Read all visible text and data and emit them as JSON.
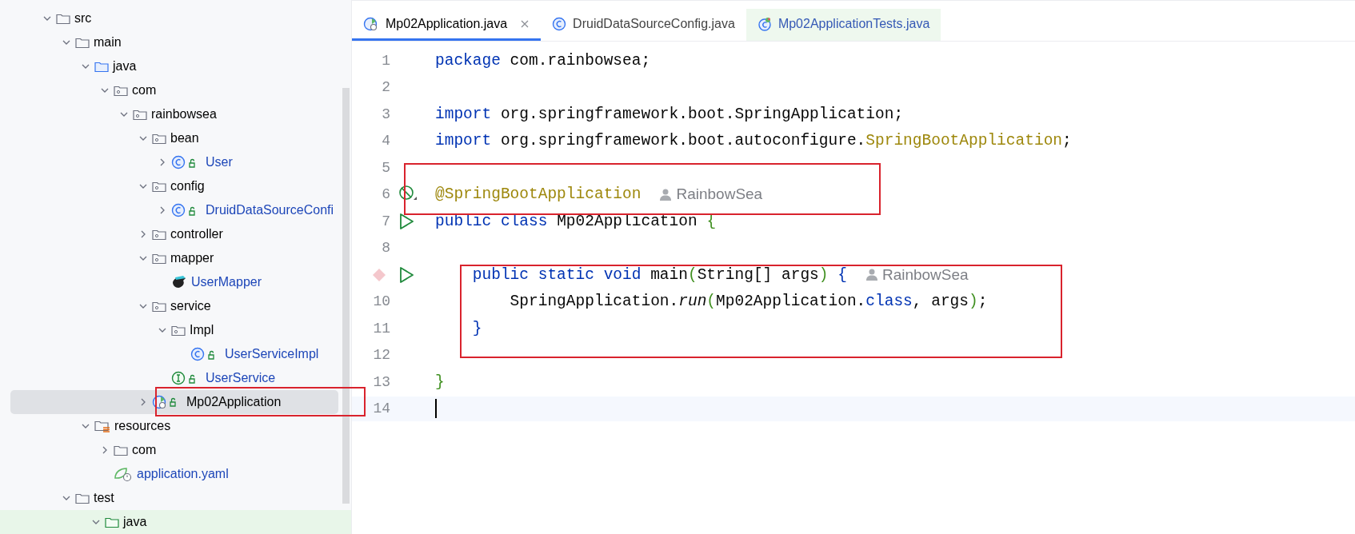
{
  "project_tree": {
    "items": [
      {
        "label": "src",
        "kind": "folder",
        "expanded": true,
        "selected": false,
        "highlighted": false,
        "children": [
          {
            "label": "main",
            "kind": "folder",
            "expanded": true,
            "selected": false,
            "highlighted": false,
            "children": [
              {
                "label": "java",
                "kind": "source-folder",
                "expanded": true,
                "selected": false,
                "highlighted": false,
                "children": [
                  {
                    "label": "com",
                    "kind": "package",
                    "expanded": true,
                    "selected": false,
                    "highlighted": false,
                    "children": [
                      {
                        "label": "rainbowsea",
                        "kind": "package",
                        "expanded": true,
                        "selected": false,
                        "highlighted": false,
                        "children": [
                          {
                            "label": "bean",
                            "kind": "package",
                            "expanded": true,
                            "selected": false,
                            "highlighted": false,
                            "children": [
                              {
                                "label": "User",
                                "kind": "class",
                                "expanded": false,
                                "selected": false,
                                "highlighted": false
                              }
                            ]
                          },
                          {
                            "label": "config",
                            "kind": "package",
                            "expanded": true,
                            "selected": false,
                            "highlighted": false,
                            "children": [
                              {
                                "label": "DruidDataSourceConfi",
                                "kind": "class",
                                "expanded": false,
                                "selected": false,
                                "highlighted": false
                              }
                            ]
                          },
                          {
                            "label": "controller",
                            "kind": "package",
                            "expanded": false,
                            "selected": false,
                            "highlighted": false
                          },
                          {
                            "label": "mapper",
                            "kind": "package",
                            "expanded": true,
                            "selected": false,
                            "highlighted": false,
                            "children": [
                              {
                                "label": "UserMapper",
                                "kind": "mapper",
                                "selected": false,
                                "highlighted": false
                              }
                            ]
                          },
                          {
                            "label": "service",
                            "kind": "package",
                            "expanded": true,
                            "selected": false,
                            "highlighted": false,
                            "children": [
                              {
                                "label": "Impl",
                                "kind": "package",
                                "expanded": true,
                                "selected": false,
                                "highlighted": false,
                                "children": [
                                  {
                                    "label": "UserServiceImpl",
                                    "kind": "class",
                                    "selected": false,
                                    "highlighted": false
                                  }
                                ]
                              },
                              {
                                "label": "UserService",
                                "kind": "interface",
                                "selected": false,
                                "highlighted": false
                              }
                            ]
                          },
                          {
                            "label": "Mp02Application",
                            "kind": "boot-class",
                            "expanded": false,
                            "selected": true,
                            "highlighted": false
                          }
                        ]
                      }
                    ]
                  }
                ]
              },
              {
                "label": "resources",
                "kind": "resources-folder",
                "expanded": true,
                "selected": false,
                "highlighted": false,
                "children": [
                  {
                    "label": "com",
                    "kind": "folder",
                    "expanded": false,
                    "selected": false,
                    "highlighted": false
                  },
                  {
                    "label": "application.yaml",
                    "kind": "yaml",
                    "selected": false,
                    "highlighted": false
                  }
                ]
              }
            ]
          },
          {
            "label": "test",
            "kind": "folder",
            "expanded": true,
            "selected": false,
            "highlighted": false,
            "children": [
              {
                "label": "java",
                "kind": "test-folder",
                "expanded": true,
                "selected": false,
                "highlighted": true
              }
            ]
          }
        ]
      }
    ]
  },
  "tabs": [
    {
      "label": "Mp02Application.java",
      "kind": "boot-class",
      "selected": true
    },
    {
      "label": "DruidDataSourceConfig.java",
      "kind": "class",
      "selected": false
    },
    {
      "label": "Mp02ApplicationTests.java",
      "kind": "test-class",
      "selected": false
    }
  ],
  "code": {
    "lines": [
      {
        "number": "1",
        "tokens": [
          {
            "text": "package",
            "kind": "keyword"
          },
          {
            "text": " com.rainbowsea;",
            "kind": "plain"
          }
        ]
      },
      {
        "number": "2"
      },
      {
        "number": "3",
        "tokens": [
          {
            "text": "import",
            "kind": "keyword"
          },
          {
            "text": " org.springframework.boot.SpringApplication;",
            "kind": "plain"
          }
        ]
      },
      {
        "number": "4",
        "tokens": [
          {
            "text": "import",
            "kind": "keyword"
          },
          {
            "text": " org.springframework.boot.autoconfigure.",
            "kind": "plain"
          },
          {
            "text": "SpringBootApplication",
            "kind": "annotation"
          },
          {
            "text": ";",
            "kind": "plain"
          }
        ]
      },
      {
        "number": "5"
      },
      {
        "number": "6",
        "kind": "bean",
        "author": "RainbowSea",
        "tokens": [
          {
            "text": "@SpringBootApplication",
            "kind": "annotation"
          }
        ]
      },
      {
        "number": "7",
        "kind": "run",
        "tokens": [
          {
            "text": "public class",
            "kind": "keyword"
          },
          {
            "text": " Mp02Application ",
            "kind": "plain"
          },
          {
            "text": "{",
            "kind": "bracket-green"
          }
        ]
      },
      {
        "number": "8"
      },
      {
        "kind": "breakpoint-run",
        "author": "RainbowSea",
        "tokens": [
          {
            "text": "    public static void",
            "kind": "keyword"
          },
          {
            "text": " main",
            "kind": "plain"
          },
          {
            "text": "(",
            "kind": "bracket-green"
          },
          {
            "text": "String[] args",
            "kind": "plain"
          },
          {
            "text": ")",
            "kind": "bracket-green"
          },
          {
            "text": " {",
            "kind": "bracket-blue"
          }
        ]
      },
      {
        "number": "10",
        "tokens": [
          {
            "text": "        SpringApplication.",
            "kind": "plain"
          },
          {
            "text": "run",
            "kind": "static-call"
          },
          {
            "text": "(",
            "kind": "bracket-green"
          },
          {
            "text": "Mp02Application.",
            "kind": "plain"
          },
          {
            "text": "class",
            "kind": "keyword"
          },
          {
            "text": ", args",
            "kind": "plain"
          },
          {
            "text": ")",
            "kind": "bracket-green"
          },
          {
            "text": ";",
            "kind": "plain"
          }
        ]
      },
      {
        "number": "11",
        "tokens": [
          {
            "text": "    }",
            "kind": "bracket-blue"
          }
        ]
      },
      {
        "number": "12"
      },
      {
        "number": "13",
        "tokens": [
          {
            "text": "}",
            "kind": "bracket-green"
          }
        ]
      },
      {
        "number": "14",
        "current": true
      }
    ]
  }
}
